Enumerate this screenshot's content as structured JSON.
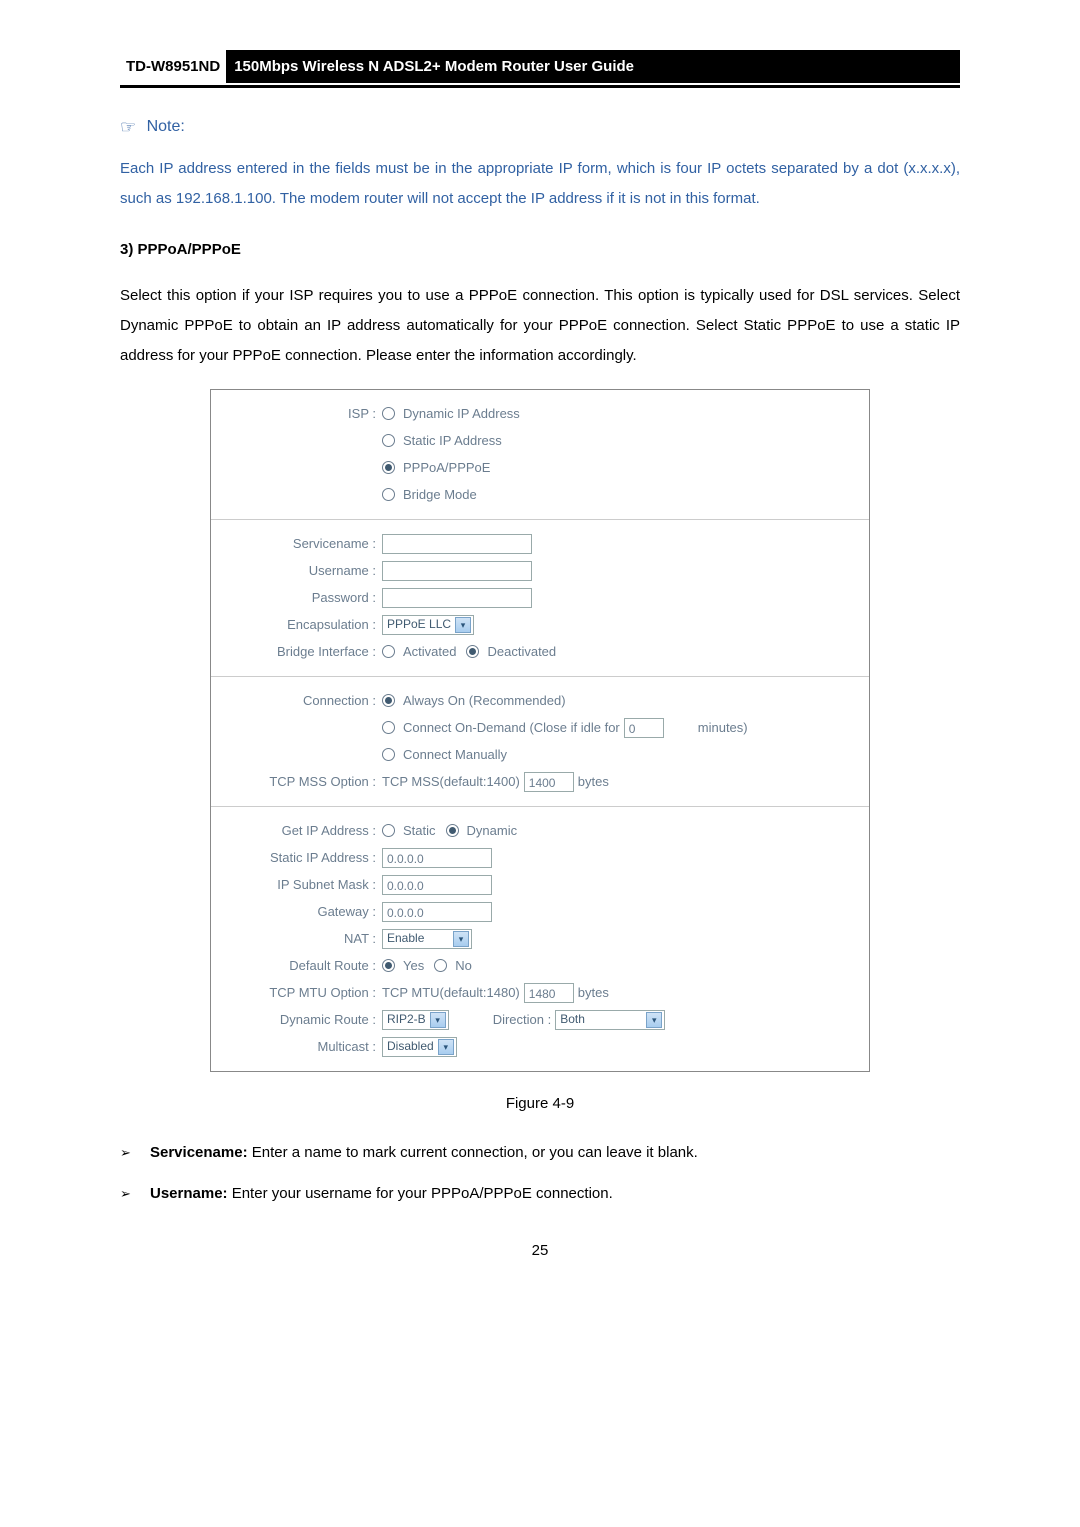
{
  "header": {
    "model": "TD-W8951ND",
    "title": "150Mbps Wireless N ADSL2+ Modem Router User Guide"
  },
  "note": {
    "label": "Note:",
    "body": "Each IP address entered in the fields must be in the appropriate IP form, which is four IP octets separated by a dot (x.x.x.x), such as 192.168.1.100. The modem router will not accept the IP address if it is not in this format."
  },
  "section": {
    "heading": "3)   PPPoA/PPPoE",
    "body": "Select this option if your ISP requires you to use a PPPoE connection. This option is typically used for DSL services. Select Dynamic PPPoE to obtain an IP address automatically for your PPPoE connection. Select Static PPPoE to use a static IP address for your PPPoE connection. Please enter the information accordingly."
  },
  "config": {
    "isp_label": "ISP :",
    "isp_dynamic": "Dynamic IP Address",
    "isp_static": "Static IP Address",
    "isp_pppoa": "PPPoA/PPPoE",
    "isp_bridge": "Bridge Mode",
    "servicename_label": "Servicename :",
    "username_label": "Username :",
    "password_label": "Password :",
    "encapsulation_label": "Encapsulation :",
    "encapsulation_value": "PPPoE LLC",
    "bridge_interface_label": "Bridge Interface :",
    "bridge_activated": "Activated",
    "bridge_deactivated": "Deactivated",
    "connection_label": "Connection :",
    "conn_always": "Always On (Recommended)",
    "conn_ondemand_pre": "Connect On-Demand (Close if idle for",
    "conn_ondemand_value": "0",
    "conn_ondemand_post": "minutes)",
    "conn_manual": "Connect Manually",
    "tcp_mss_label": "TCP MSS Option :",
    "tcp_mss_pre": "TCP MSS(default:1400)",
    "tcp_mss_value": "1400",
    "bytes": "bytes",
    "getip_label": "Get IP Address :",
    "getip_static": "Static",
    "getip_dynamic": "Dynamic",
    "static_ip_label": "Static IP Address :",
    "static_ip_value": "0.0.0.0",
    "subnet_label": "IP Subnet Mask :",
    "subnet_value": "0.0.0.0",
    "gateway_label": "Gateway :",
    "gateway_value": "0.0.0.0",
    "nat_label": "NAT :",
    "nat_value": "Enable",
    "default_route_label": "Default Route :",
    "yes": "Yes",
    "no": "No",
    "tcp_mtu_label": "TCP MTU Option :",
    "tcp_mtu_pre": "TCP MTU(default:1480)",
    "tcp_mtu_value": "1480",
    "dynamic_route_label": "Dynamic Route :",
    "dynamic_route_value": "RIP2-B",
    "direction_label": "Direction :",
    "direction_value": "Both",
    "multicast_label": "Multicast :",
    "multicast_value": "Disabled"
  },
  "figure_caption": "Figure 4-9",
  "bullets": [
    {
      "bold": "Servicename:",
      "text": " Enter a name to mark current connection, or you can leave it blank."
    },
    {
      "bold": "Username:",
      "text": " Enter your username for your PPPoA/PPPoE connection."
    }
  ],
  "page_number": "25"
}
